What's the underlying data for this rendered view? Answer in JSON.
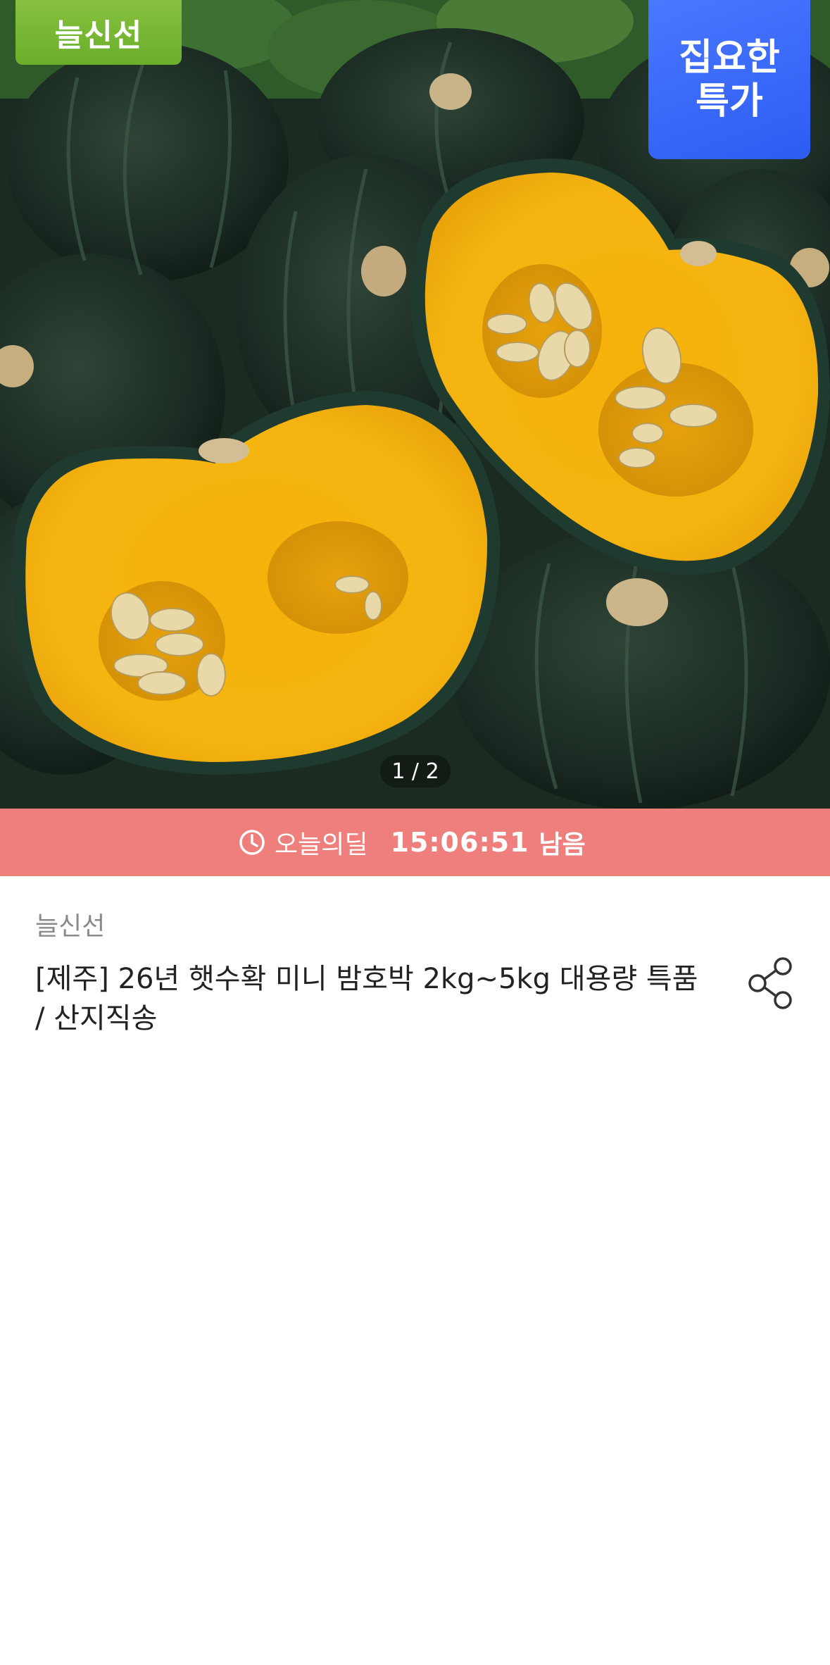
{
  "hero": {
    "badge_left": "늘신선",
    "badge_right_line1": "집요한",
    "badge_right_line2": "특가",
    "pager": "1 / 2"
  },
  "deal_bar": {
    "icon": "clock-icon",
    "label": "오늘의딜",
    "time": "15:06:51",
    "remaining": "남음",
    "arrow_icon": "chevron-right-icon",
    "color": "#ef7f7c"
  },
  "product": {
    "seller": "늘신선",
    "title": "[제주] 26년 햇수확 미니 밤호박 2kg~5kg 대용량 특품 / 산지직송",
    "share_icon": "share-icon"
  }
}
